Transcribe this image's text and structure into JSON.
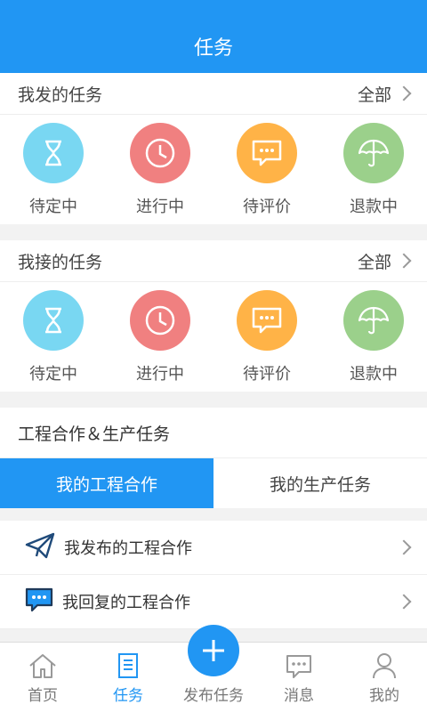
{
  "header": {
    "title": "任务"
  },
  "my_published": {
    "title": "我发的任务",
    "more_label": "全部",
    "items": [
      {
        "label": "待定中",
        "icon": "hourglass-icon",
        "color": "#79d7f2"
      },
      {
        "label": "进行中",
        "icon": "clock-icon",
        "color": "#f08080"
      },
      {
        "label": "待评价",
        "icon": "comment-icon",
        "color": "#ffb347"
      },
      {
        "label": "退款中",
        "icon": "umbrella-icon",
        "color": "#9bd08b"
      }
    ]
  },
  "my_received": {
    "title": "我接的任务",
    "more_label": "全部",
    "items": [
      {
        "label": "待定中",
        "icon": "hourglass-icon",
        "color": "#79d7f2"
      },
      {
        "label": "进行中",
        "icon": "clock-icon",
        "color": "#f08080"
      },
      {
        "label": "待评价",
        "icon": "comment-icon",
        "color": "#ffb347"
      },
      {
        "label": "退款中",
        "icon": "umbrella-icon",
        "color": "#9bd08b"
      }
    ]
  },
  "cooperation": {
    "title": "工程合作＆生产任务",
    "tabs": [
      {
        "label": "我的工程合作"
      },
      {
        "label": "我的生产任务"
      }
    ],
    "list": [
      {
        "label": "我发布的工程合作",
        "icon": "paper-plane-icon"
      },
      {
        "label": "我回复的工程合作",
        "icon": "chat-bubble-icon"
      }
    ]
  },
  "bottom_nav": {
    "items": [
      {
        "label": "首页",
        "icon": "home-icon"
      },
      {
        "label": "任务",
        "icon": "task-icon"
      },
      {
        "label": "发布任务",
        "icon": "plus-icon"
      },
      {
        "label": "消息",
        "icon": "message-icon"
      },
      {
        "label": "我的",
        "icon": "user-icon"
      }
    ]
  },
  "colors": {
    "primary": "#2196f3"
  }
}
